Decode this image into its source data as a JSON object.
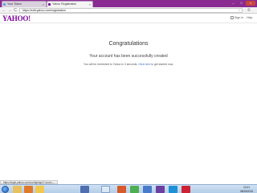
{
  "browser": {
    "tabs": [
      {
        "label": "Your Token",
        "favicon_color": "#5aa0e0"
      },
      {
        "label": "Yahoo Registration",
        "favicon_color": "#7b0099"
      }
    ],
    "address": "https://edit.yahoo.com/registration",
    "close_glyph": "×",
    "min_glyph": "–",
    "max_glyph": "□",
    "back_glyph": "←",
    "forward_glyph": "→",
    "reload_glyph": "C",
    "star_glyph": "☆",
    "menu_glyph": "≡"
  },
  "header": {
    "logo": "YAHOO!",
    "signin": "Sign In",
    "help": "Help"
  },
  "main": {
    "title": "Congratulations",
    "message": "Your account has been successfully created",
    "redirect_before": "You will be redirected to Yahoo in 3 seconds. ",
    "redirect_link": "Click here",
    "redirect_after": " to get started now."
  },
  "statusbar": {
    "text": "https://login.yahoo.com/config/login?.done=..."
  },
  "taskbar": {
    "apps": [
      {
        "name": "explorer",
        "color": "#e8c060"
      },
      {
        "name": "media-player",
        "color": "#e07a2a"
      },
      {
        "name": "folder",
        "color": "#f0c850"
      },
      {
        "name": "app",
        "color": "#4f6fb0"
      },
      {
        "name": "outlook",
        "color": "#2b6cc4"
      },
      {
        "name": "browser",
        "color": "#d85a2a"
      },
      {
        "name": "chrome",
        "color": "#4caf50"
      },
      {
        "name": "app2",
        "color": "#4a7acb"
      },
      {
        "name": "app3",
        "color": "#6a3fa0"
      },
      {
        "name": "app4",
        "color": "#1e90d6"
      },
      {
        "name": "opera",
        "color": "#cc2233"
      }
    ],
    "time": "10:41",
    "date": "08/25/2015"
  },
  "colors": {
    "brand": "#7b0099",
    "link": "#3a6ec8",
    "titlebar": "#8a2b91"
  }
}
